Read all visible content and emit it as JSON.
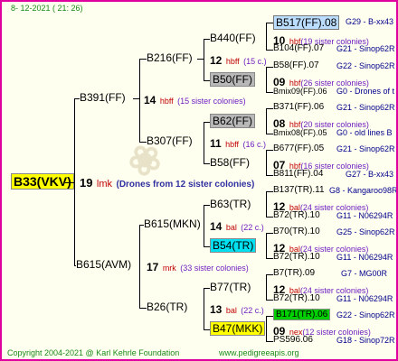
{
  "header": {
    "date": "8- 12-2021 ( 21: 26)"
  },
  "footer": {
    "copyright": "Copyright 2004-2021 @ Karl Kehrle Foundation",
    "site": "www.pedigreeapis.org"
  },
  "root": {
    "name": "B33(VKV)",
    "num": "19",
    "code": "lmk",
    "note": "(Drones from 12 sister colonies)"
  },
  "gen1": [
    {
      "name": "B391(FF)",
      "num": "14",
      "code": "hbff",
      "note": "(15 sister colonies)"
    },
    {
      "name": "B615(AVM)",
      "num": "17",
      "code": "mrk",
      "note": "(33 sister colonies)"
    }
  ],
  "gen2": [
    {
      "name": "B216(FF)",
      "num": "12",
      "code": "hbff",
      "note": "(15 c.)"
    },
    {
      "name": "B307(FF)",
      "num": "11",
      "code": "hbff",
      "note": "(16 c.)"
    },
    {
      "name": "B615(MKN)",
      "num": "14",
      "code": "bal",
      "note": "(22 c.)"
    },
    {
      "name": "B26(TR)",
      "num": "13",
      "code": "bal",
      "note": "(22 c.)"
    }
  ],
  "gen3": [
    {
      "name": "B440(FF)",
      "num": "10",
      "code": "hbf",
      "note": "(19 sister colonies)"
    },
    {
      "name": "B50(FF)",
      "num": "09",
      "code": "hbf",
      "note": "(26 sister colonies)"
    },
    {
      "name": "B62(FF)",
      "num": "08",
      "code": "hbf",
      "note": "(20 sister colonies)"
    },
    {
      "name": "B58(FF)",
      "num": "07",
      "code": "hbf",
      "note": "(16 sister colonies)"
    },
    {
      "name": "B63(TR)",
      "num": "12",
      "code": "bal",
      "note": "(24 sister colonies)"
    },
    {
      "name": "B54(TR)",
      "num": "12",
      "code": "bal",
      "note": "(24 sister colonies)"
    },
    {
      "name": "B77(TR)",
      "num": "12",
      "code": "bal",
      "note": "(24 sister colonies)"
    },
    {
      "name": "B47(MKK)",
      "num": "09",
      "code": "nex",
      "note": "(12 sister colonies)"
    }
  ],
  "gen4": [
    {
      "name": "B517(FF).08",
      "gen": "G29 - B-xx43"
    },
    {
      "name": "B104(FF).07",
      "gen": "G21 - Sinop62R"
    },
    {
      "name": "B58(FF).07",
      "gen": "G22 - Sinop62R"
    },
    {
      "name": "Bmix09(FF).06",
      "gen": "G0 - Drones of t"
    },
    {
      "name": "B371(FF).06",
      "gen": "G21 - Sinop62R"
    },
    {
      "name": "Bmix08(FF).05",
      "gen": "G0 - old lines B"
    },
    {
      "name": "B677(FF).05",
      "gen": "G21 - Sinop62R"
    },
    {
      "name": "B811(FF).04",
      "gen": "G27 - B-xx43"
    },
    {
      "name": "B137(TR).11",
      "gen": "G8 - Kangaroo98R"
    },
    {
      "name": "B72(TR).10",
      "gen": "G11 - N06294R"
    },
    {
      "name": "B70(TR).10",
      "gen": "G25 - Sinop62R"
    },
    {
      "name": "B72(TR).10",
      "gen": "G11 - N06294R"
    },
    {
      "name": "B7(TR).09",
      "gen": "G7 - MG00R"
    },
    {
      "name": "B72(TR).10",
      "gen": "G11 - N06294R"
    },
    {
      "name": "B171(TR).06",
      "gen": "G22 - Sinop62R"
    },
    {
      "name": "PS596.06",
      "gen": "G18 - Sinop72R"
    }
  ]
}
